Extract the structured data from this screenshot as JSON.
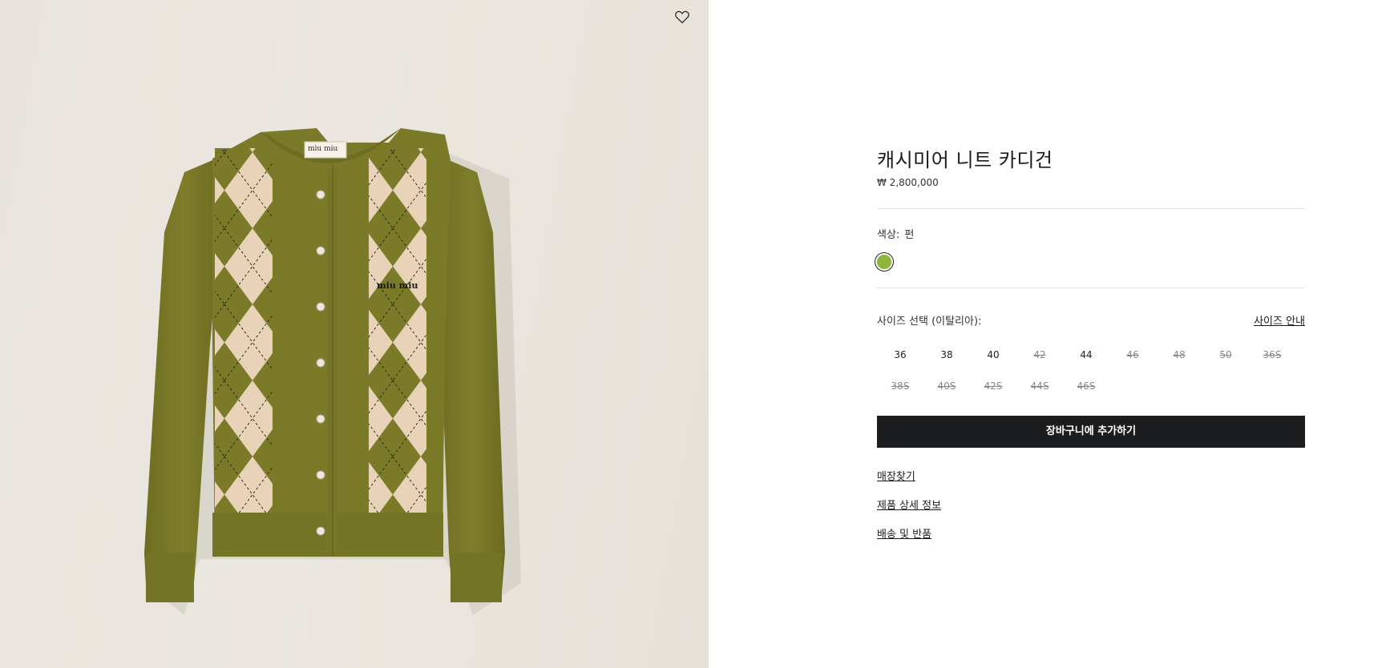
{
  "product": {
    "title": "캐시미어 니트 카디건",
    "price": "₩ 2,800,000",
    "brand_label": "miu miu",
    "chest_logo": "miu miu"
  },
  "wishlist": {
    "icon": "heart-icon"
  },
  "color": {
    "label": "색상:",
    "value": "펀",
    "swatch_color": "#8db63a"
  },
  "size": {
    "label": "사이즈 선택 (이탈리아):",
    "guide_label": "사이즈 안내",
    "options": [
      {
        "label": "36",
        "available": true
      },
      {
        "label": "38",
        "available": true
      },
      {
        "label": "40",
        "available": true
      },
      {
        "label": "42",
        "available": false
      },
      {
        "label": "44",
        "available": true
      },
      {
        "label": "46",
        "available": false
      },
      {
        "label": "48",
        "available": false
      },
      {
        "label": "50",
        "available": false
      },
      {
        "label": "36S",
        "available": false
      },
      {
        "label": "38S",
        "available": false
      },
      {
        "label": "40S",
        "available": false
      },
      {
        "label": "42S",
        "available": false
      },
      {
        "label": "44S",
        "available": false
      },
      {
        "label": "46S",
        "available": false
      }
    ]
  },
  "actions": {
    "add_to_cart": "장바구니에 추가하기",
    "find_store": "매장찾기",
    "product_details": "제품 상세 정보",
    "shipping_returns": "배송 및 반품"
  },
  "colors": {
    "knit": "#7a7a28",
    "argyle_light": "#e9d3b8",
    "button_bar": "#1c1d1f"
  }
}
